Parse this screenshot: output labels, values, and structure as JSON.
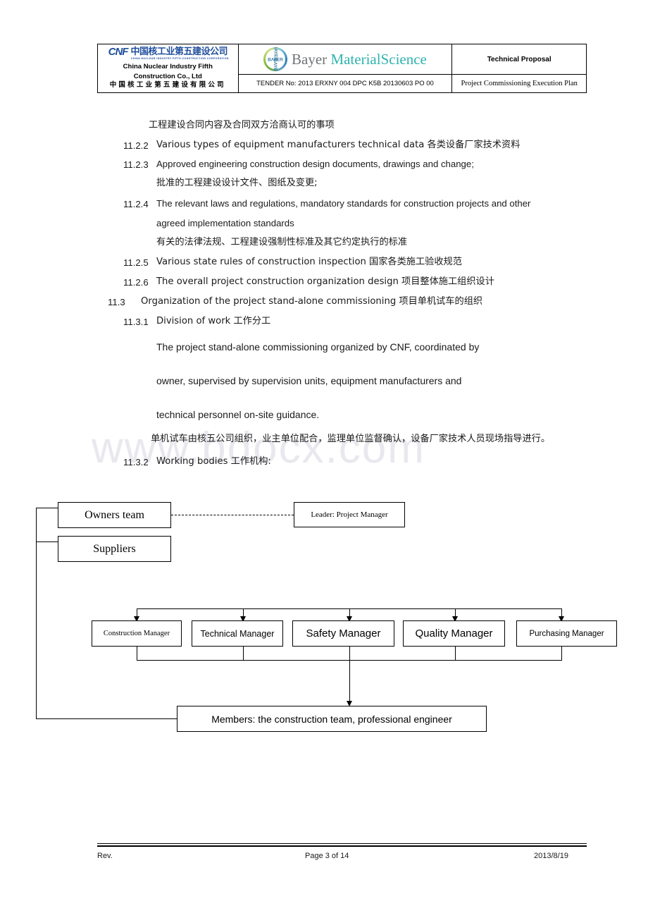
{
  "document": {
    "watermark": "www.bdocx.com"
  },
  "header": {
    "cnf": {
      "mark": "CNF",
      "company_cn_logo": "中国核工业第五建设公司",
      "logo_sub_en": "CHINA NUCLEAR INDUSTRY FIFTH CONSTRUCTION CORPORATION",
      "name_en_line1": "China Nuclear Industry Fifth",
      "name_en_line2": "Construction Co., Ltd",
      "name_cn": "中国核工业第五建设有限公司"
    },
    "bayer": {
      "brand_part1": "Bayer ",
      "brand_part2": "MaterialScience",
      "cross_label": "BAYER",
      "tender_no": "TENDER No: 2013 ERXNY 004 DPC K5B 20130603 PO 00"
    },
    "right": {
      "doc_type": "Technical Proposal",
      "plan_title": "Project Commissioning Execution Plan"
    }
  },
  "body": {
    "lines": [
      {
        "num": "",
        "text": "工程建设合同内容及合同双方洽商认可的事项"
      },
      {
        "num": "11.2.2",
        "text": "Various types of equipment manufacturers technical data 各类设备厂家技术资料"
      },
      {
        "num": "11.2.3",
        "text": "Approved engineering construction design documents, drawings and change;"
      },
      {
        "num": "",
        "text": "批准的工程建设设计文件、图纸及变更;"
      },
      {
        "num": "11.2.4",
        "text": "The relevant laws and regulations, mandatory standards for construction projects and other"
      },
      {
        "num": "",
        "text": "agreed implementation standards"
      },
      {
        "num": "",
        "text": "有关的法律法规、工程建设强制性标准及其它约定执行的标准"
      },
      {
        "num": "11.2.5",
        "text": "Various state rules of construction inspection 国家各类施工验收规范"
      },
      {
        "num": "11.2.6",
        "text": "The overall project construction organization design 项目整体施工组织设计"
      },
      {
        "num": "11.3",
        "text": "Organization of the project stand-alone commissioning 项目单机试车的组织"
      },
      {
        "num": "11.3.1",
        "text": "Division of work 工作分工"
      }
    ],
    "paragraph": {
      "line1": "The project stand-alone commissioning organized by CNF, coordinated by",
      "line2": "owner, supervised by supervision units, equipment manufacturers and",
      "line3": "technical personnel on-site guidance.",
      "line_cn": "单机试车由核五公司组织，业主单位配合，监理单位监督确认，设备厂家技术人员现场指导进行。"
    },
    "working_bodies": {
      "num": "11.3.2",
      "text": "Working bodies 工作机构:"
    }
  },
  "org_chart": {
    "owners_team": "Owners team",
    "suppliers": "Suppliers",
    "leader": "Leader: Project Manager",
    "managers": [
      "Construction Manager",
      "Technical Manager",
      "Safety Manager",
      "Quality Manager",
      "Purchasing Manager"
    ],
    "members": "Members: the construction team, professional engineer"
  },
  "footer": {
    "revision": "Rev.",
    "page": "Page 3 of 14",
    "date": "2013/8/19"
  }
}
